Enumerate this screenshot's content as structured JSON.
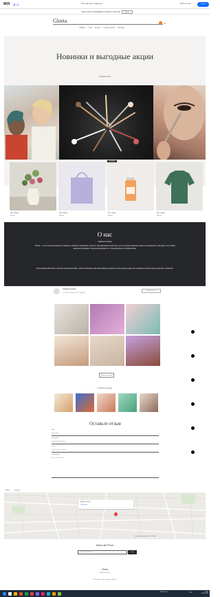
{
  "wixbar": {
    "logo": "WiX",
    "center_text": "Этот сайт был создан на...",
    "signin": "Войти на сайт",
    "cta": "Начать"
  },
  "promo": {
    "text": "Статья рейтинг, распродажа и обзоры от экспертов",
    "button": "Узнать"
  },
  "header": {
    "brand": "Gloria",
    "nav": [
      "Главная",
      "О нас",
      "Каталог",
      "Отзывы и блоги",
      "Контакты"
    ]
  },
  "hero": {
    "title": "Новинки и выгодные акции",
    "subtitle": "Смотреть все"
  },
  "products": [
    {
      "name": "Имя товара",
      "price": "$25.00",
      "badge": "",
      "color": "#f5f0ea"
    },
    {
      "name": "Имя товара",
      "price": "$25.00",
      "badge": "",
      "color": "#f2f1f6"
    },
    {
      "name": "Имя товара",
      "price": "$25.00",
      "badge": "НОВИНКА",
      "color": "#f4f1ee"
    },
    {
      "name": "Имя товара",
      "price": "$25.00",
      "badge": "",
      "color": "#eeece9"
    }
  ],
  "about": {
    "title": "О нас",
    "subtitle": "Наша история",
    "p1": "«Gloria» — это стильная компания, созданная с любовью и вниманием к красоте. Мы предлагаем косметику и уход, который подчеркнёт вашу естественность. Мы верим, что каждая женщина заслуживает ощущения уверенности и привлекательности каждый день.",
    "p2": "Наша команда работает с лучшими производителями, чтобы предложить вам качественные продукты по доступным ценам. Мы стремимся сделать вашу жизнь ярче и приятнее."
  },
  "instagram": {
    "name": "Instagram Gloria",
    "stats": "0 Постов   0 Подписчиков   0 Подписок",
    "follow": "Подписаться",
    "load_more": "Показать больше"
  },
  "tagged": {
    "title": "Следите за нами"
  },
  "review": {
    "title": "Оставьте отзыв",
    "fields": [
      {
        "label": "Имя",
        "value": "Ваше имя"
      },
      {
        "label": "Эл. почта*",
        "value": "youremail@mail.com"
      },
      {
        "label": "Тема",
        "value": "Тема вашего отзыва"
      },
      {
        "label": "Сообщение",
        "value": "Ваше сообщение..."
      }
    ],
    "submit": "Отправить"
  },
  "map": {
    "tabs": [
      "Карта",
      "Спутник"
    ],
    "card_title": "Москва, Россия",
    "card_link": "Подробнее",
    "credits": "Картографические данные © 2024 Google"
  },
  "subscribe": {
    "title": "Subscribe Form",
    "placeholder": "Enter your email here",
    "button": "Join"
  },
  "footer": {
    "brand": "Gloria",
    "email": "info@mysite.com",
    "copyright": "© 2024 Gloria. Сайт создан на Wix.com"
  },
  "taskbar": {
    "weather": "20°C Ясно",
    "lang": "РУС",
    "time": "18:45",
    "date": "12.05.2024"
  },
  "colors": {
    "dark": "#26272b",
    "accent_orange": "#f07b1e",
    "wix_blue": "#116dff"
  }
}
